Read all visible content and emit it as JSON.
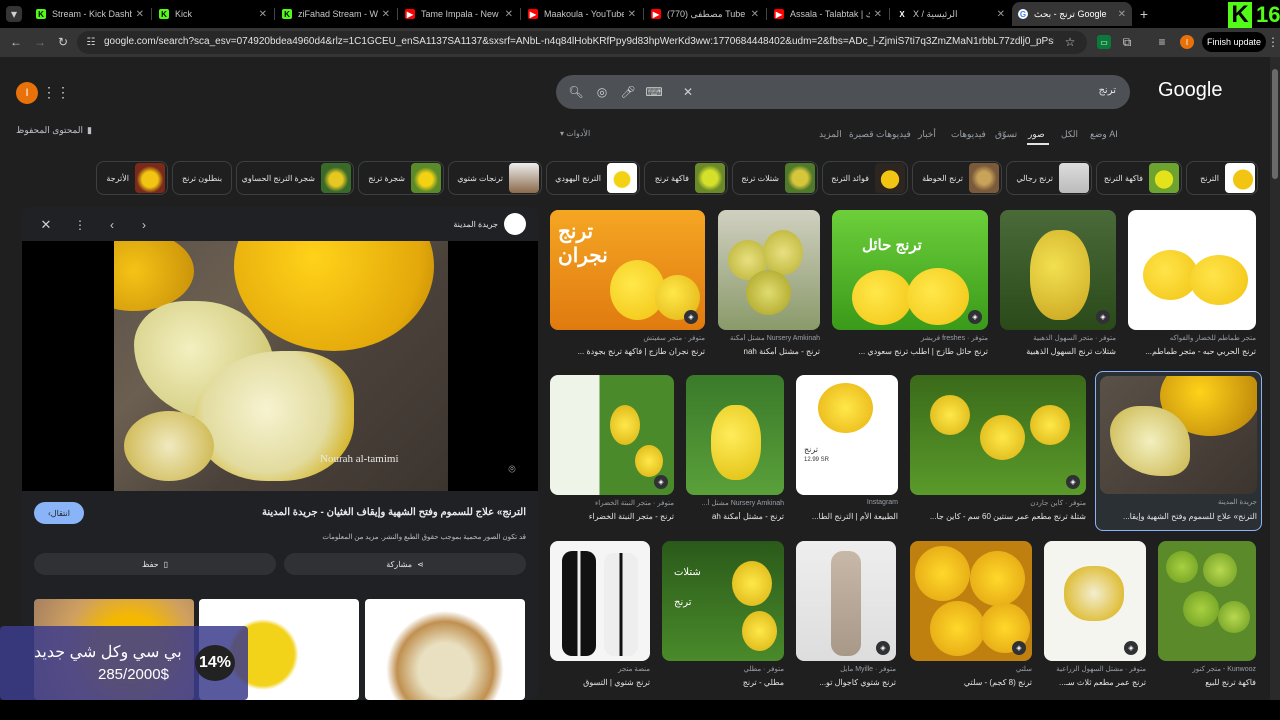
{
  "tabs": [
    {
      "title": "Stream - Kick Dashbo",
      "icon": "kick-icon",
      "color": "#53fc18",
      "letter": "K"
    },
    {
      "title": "Kick",
      "icon": "kick-icon",
      "color": "#53fc18",
      "letter": "K"
    },
    {
      "title": "ziFahad Stream - Wa",
      "icon": "kick-icon",
      "color": "#53fc18",
      "letter": "K"
    },
    {
      "title": "Tame Impala - New P",
      "icon": "youtube-icon",
      "color": "#ff0000",
      "letter": "▶"
    },
    {
      "title": "Maakoula - YouTube",
      "icon": "youtube-icon",
      "color": "#ff0000",
      "letter": "▶"
    },
    {
      "title": "(770) مصطفى Tube",
      "icon": "youtube-icon",
      "color": "#ff0000",
      "letter": "▶"
    },
    {
      "title": "Assala - Talabtak | لك",
      "icon": "youtube-icon",
      "color": "#ff0000",
      "letter": "▶"
    },
    {
      "title": "X / الرئيسية",
      "icon": "x-icon",
      "color": "#000000",
      "letter": "X"
    },
    {
      "title": "ترنج - بحث Google",
      "icon": "google-icon",
      "color": "#ffffff",
      "letter": "G"
    }
  ],
  "new_tab": "+",
  "url": "google.com/search?sca_esv=074920bdea4960d4&rlz=1C1GCEU_enSA1137SA1137&sxsrf=ANbL-n4q84lHobKRfPpy9d83hpWerKd3ww:1770684448402&udm=2&fbs=ADc_l-ZjmiS7ti7q3ZmZMaN1rbbL77zdlj0_pPsiCUGaLZnQ8yio9e...",
  "finish_update": "Finish update",
  "kick_counter": "16",
  "profile_letter": "I",
  "search_query": "ترنج",
  "logo": "Google",
  "saved_content": "المحتوى المحفوظ",
  "tools": "الأدوات",
  "nav_tabs": [
    "وضع AI",
    "الكل",
    "صور",
    "تسوّق",
    "فيديوهات",
    "أخبار",
    "فيديوهات قصيرة",
    "المزيد"
  ],
  "chips": [
    "الترنج",
    "فاكهة الترنج",
    "ترنج رجالي",
    "ترنج الحوطة",
    "فوائد الترنج",
    "شتلات ترنج",
    "فاكهة ترنج",
    "الترنج اليهودي",
    "ترنجات شتوي",
    "شجرة ترنج",
    "شجرة الترنج الحساوي",
    "بنطلون ترنج",
    "الأترجة"
  ],
  "preview": {
    "source": "جريدة المدينة",
    "title": "الترنج» علاج للسموم وفتح الشهية وإيقاف الغثيان - جريدة المدينة",
    "note": "قد تكون الصور محمية بموجب حقوق الطبع والنشر. مزيد من المعلومات",
    "visit": "انتقال",
    "share": "مشاركة",
    "save": "حفظ",
    "watermark": "Nourah al-tamimi"
  },
  "grid": [
    {
      "title": "ترنج الحربي حبه - متجر طماطم...",
      "source": "متجر طماطم للخضار والفواكه"
    },
    {
      "title": "شتلات ترنج السهول الذهبية",
      "source": "متوفر · متجر السهول الذهبية"
    },
    {
      "title": "ترنج حائل طازج | اطلب ترنج سعودي ...",
      "source": "متوفر · freshes فريشز"
    },
    {
      "title": "ترنج - مشتل أمكنة nah",
      "source": "Nursery Amkinah مشتل أمكنة"
    },
    {
      "title": "ترنج نجران طازج | فاكهة ترنج بجودة ...",
      "source": "متوفر · متجر سفيتش"
    },
    {
      "title": "الترنج» علاج للسموم وفتح الشهية وإيقا...",
      "source": "جريدة المدينة"
    },
    {
      "title": "شتلة ترنج مطعم عمر سنتين 60 سم - كاين جا...",
      "source": "متوفر · كاين جاردن"
    },
    {
      "title": "الطبيعة الأم | الترنج الطا...",
      "source": "Instagram"
    },
    {
      "title": "ترنج - مشتل أمكنة ah",
      "source": "Nursery Amkinah مشتل أ..."
    },
    {
      "title": "ترنج - متجر النبتة الخضراء",
      "source": "متوفر · متجر النبتة الخضراء"
    },
    {
      "title": "فاكهة ترنج للبيع",
      "source": "Kunwooz - متجر كنوز"
    },
    {
      "title": "ترنج عمر مطعم ثلاث سـ...",
      "source": "متوفر · مشتل السهول الزراعية"
    },
    {
      "title": "ترنج (8 كجم) - سلتي",
      "source": "سلتي"
    },
    {
      "title": "ترنج شتوي كاجوال تو...",
      "source": "متوفر · Myille مايل"
    },
    {
      "title": "مطلي - ترنج",
      "source": "متوفر · مطلي"
    },
    {
      "title": "ترنج شتوي | التسوق",
      "source": "منصة متجر"
    }
  ],
  "grid_text": {
    "tarnj": "ترنج",
    "najran": "ترنج\nنجران",
    "hail": "ترنج حائل",
    "shatlat": "شتلات",
    "price": "12.99 SR"
  },
  "ad": {
    "title": "بي سي وكل شي جديد",
    "progress": "285/2000$",
    "percent": "14%"
  },
  "colors": {
    "accent": "#8ab4f8",
    "kick": "#53fc18"
  }
}
